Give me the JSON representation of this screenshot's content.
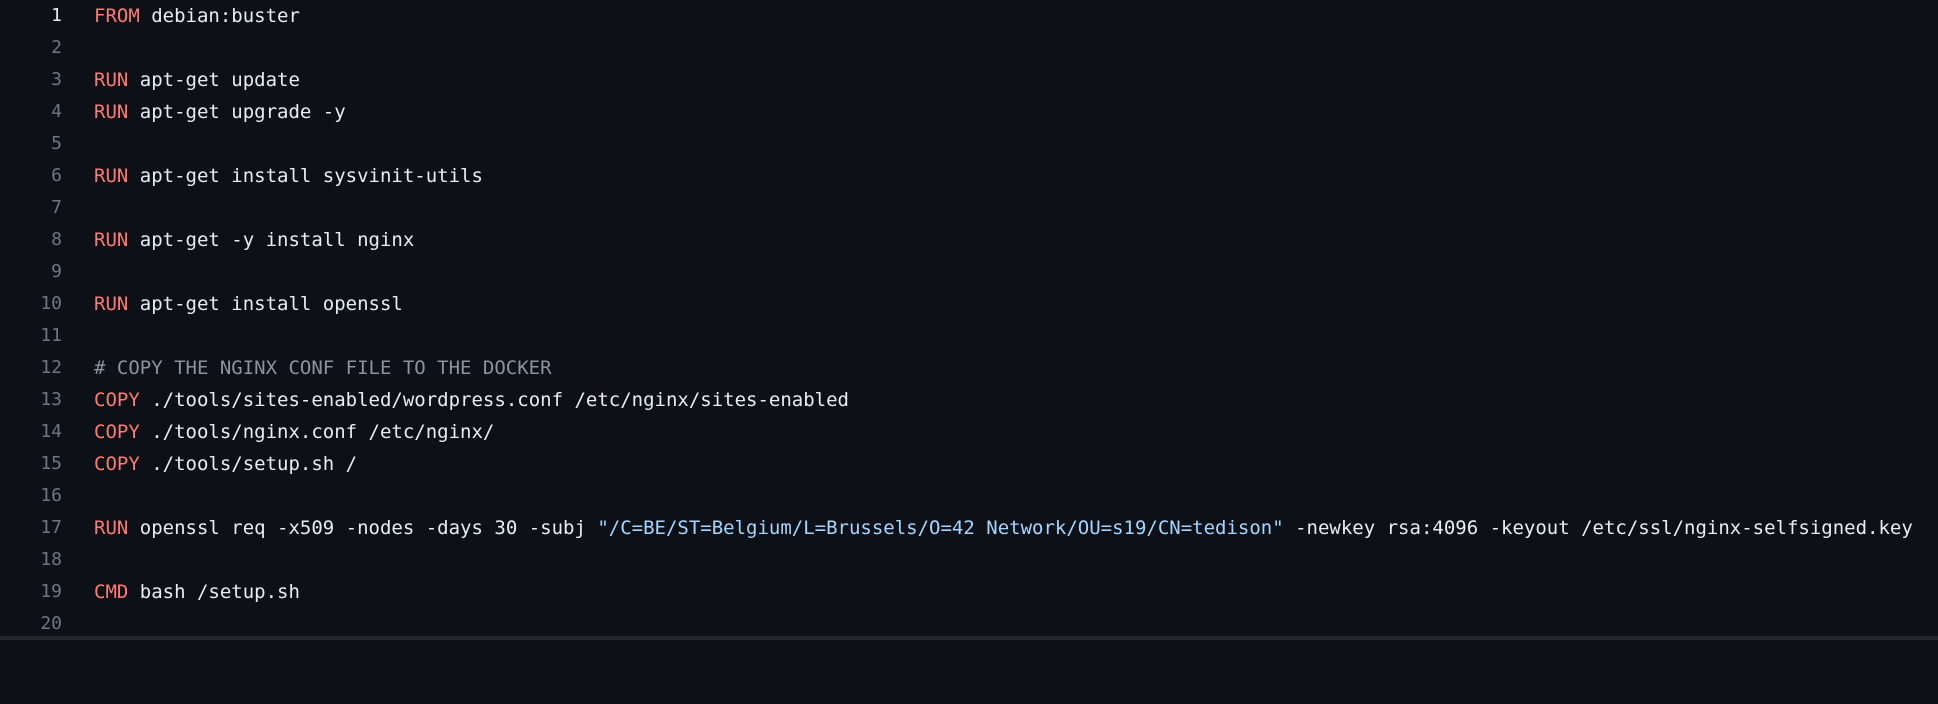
{
  "editor": {
    "colors": {
      "background": "#0d1117",
      "keyword": "#ff7b72",
      "text": "#e6edf3",
      "comment": "#8b949e",
      "string": "#a5d6ff",
      "line_number": "#6e7681"
    },
    "lines": [
      {
        "num": "1",
        "kw": "FROM",
        "text": " debian:buster"
      },
      {
        "num": "2"
      },
      {
        "num": "3",
        "kw": "RUN",
        "text": " apt-get update"
      },
      {
        "num": "4",
        "kw": "RUN",
        "text": " apt-get upgrade -y"
      },
      {
        "num": "5"
      },
      {
        "num": "6",
        "kw": "RUN",
        "text": " apt-get install sysvinit-utils"
      },
      {
        "num": "7"
      },
      {
        "num": "8",
        "kw": "RUN",
        "text": " apt-get -y install nginx"
      },
      {
        "num": "9"
      },
      {
        "num": "10",
        "kw": "RUN",
        "text": " apt-get install openssl"
      },
      {
        "num": "11"
      },
      {
        "num": "12",
        "comment": "# COPY THE NGINX CONF FILE TO THE DOCKER"
      },
      {
        "num": "13",
        "kw": "COPY",
        "text": " ./tools/sites-enabled/wordpress.conf /etc/nginx/sites-enabled"
      },
      {
        "num": "14",
        "kw": "COPY",
        "text": " ./tools/nginx.conf /etc/nginx/"
      },
      {
        "num": "15",
        "kw": "COPY",
        "text": " ./tools/setup.sh /"
      },
      {
        "num": "16"
      },
      {
        "num": "17",
        "kw": "RUN",
        "text": " openssl req -x509 -nodes -days 30 -subj ",
        "str": "\"/C=BE/ST=Belgium/L=Brussels/O=42 Network/OU=s19/CN=tedison\"",
        "text2": " -newkey rsa:4096 -keyout /etc/ssl/nginx-selfsigned.key"
      },
      {
        "num": "18"
      },
      {
        "num": "19",
        "kw": "CMD",
        "text": " bash /setup.sh"
      },
      {
        "num": "20"
      }
    ]
  }
}
